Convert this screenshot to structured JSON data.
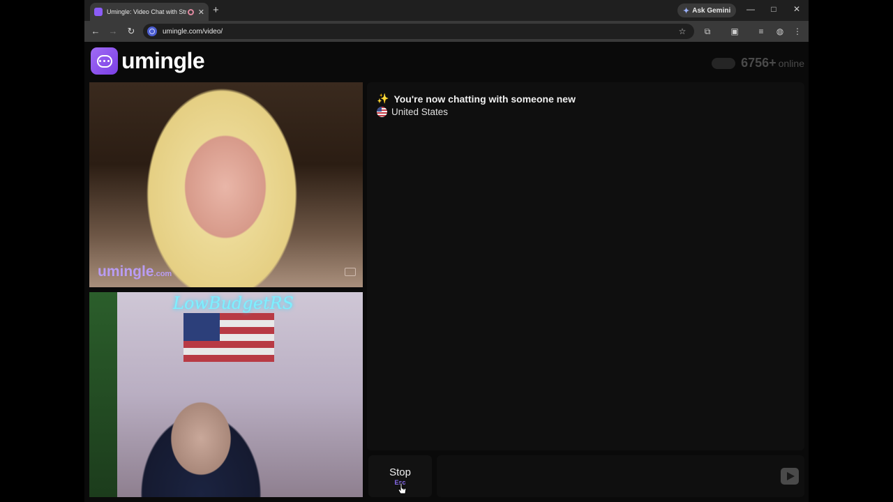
{
  "browser": {
    "tab_title": "Umingle: Video Chat with Strangers",
    "new_tab": "+",
    "close_tab": "✕",
    "ask_gemini": "Ask Gemini",
    "url": "umingle.com/video/"
  },
  "header": {
    "logo_text": "umingle",
    "online_count": "6756+",
    "online_label": "online"
  },
  "video": {
    "watermark_name": "umingle",
    "watermark_domain": ".com",
    "neon_sign": "LowBudgetRS"
  },
  "chat": {
    "system_message": "You're now chatting with someone new",
    "country": "United States",
    "input_value": ""
  },
  "controls": {
    "stop_label": "Stop",
    "stop_hint": "Esc"
  },
  "colors": {
    "brand": "#8b5cf6",
    "background": "#0a0a0a",
    "panel": "#0f0f0f"
  }
}
